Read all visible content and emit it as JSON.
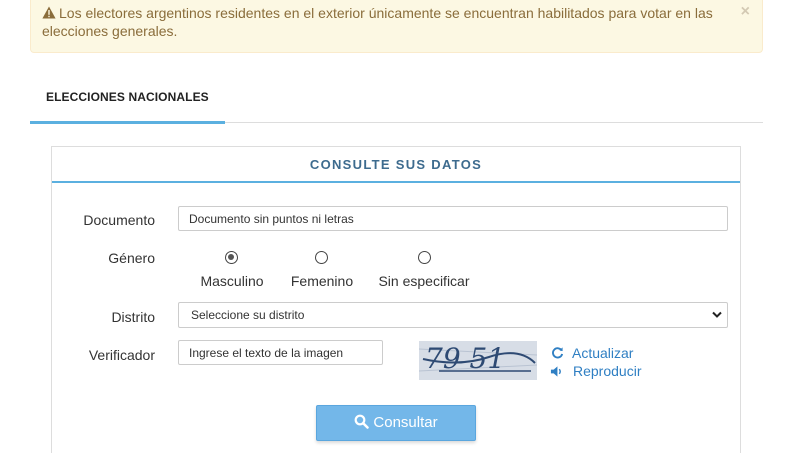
{
  "alert": {
    "text": "Los electores argentinos residentes en el exterior únicamente se encuentran habilitados para votar en las elecciones generales.",
    "close": "×"
  },
  "tabs": [
    {
      "label": "ELECCIONES NACIONALES",
      "active": true
    }
  ],
  "form": {
    "title": "CONSULTE SUS DATOS",
    "documento": {
      "label": "Documento",
      "placeholder": "Documento sin puntos ni letras"
    },
    "genero": {
      "label": "Género",
      "options": [
        "Masculino",
        "Femenino",
        "Sin especificar"
      ],
      "selected": "Masculino"
    },
    "distrito": {
      "label": "Distrito",
      "selected": "Seleccione su distrito"
    },
    "verificador": {
      "label": "Verificador",
      "placeholder": "Ingrese el texto de la imagen",
      "captcha_text": "79 51",
      "refresh": "Actualizar",
      "audio": "Reproducir"
    },
    "submit": "Consultar"
  },
  "colors": {
    "accent": "#5bb0e0",
    "button": "#73b7e9",
    "link": "#2f7fc3",
    "alert_bg": "#fcf8e3",
    "alert_text": "#8a6d3b"
  }
}
